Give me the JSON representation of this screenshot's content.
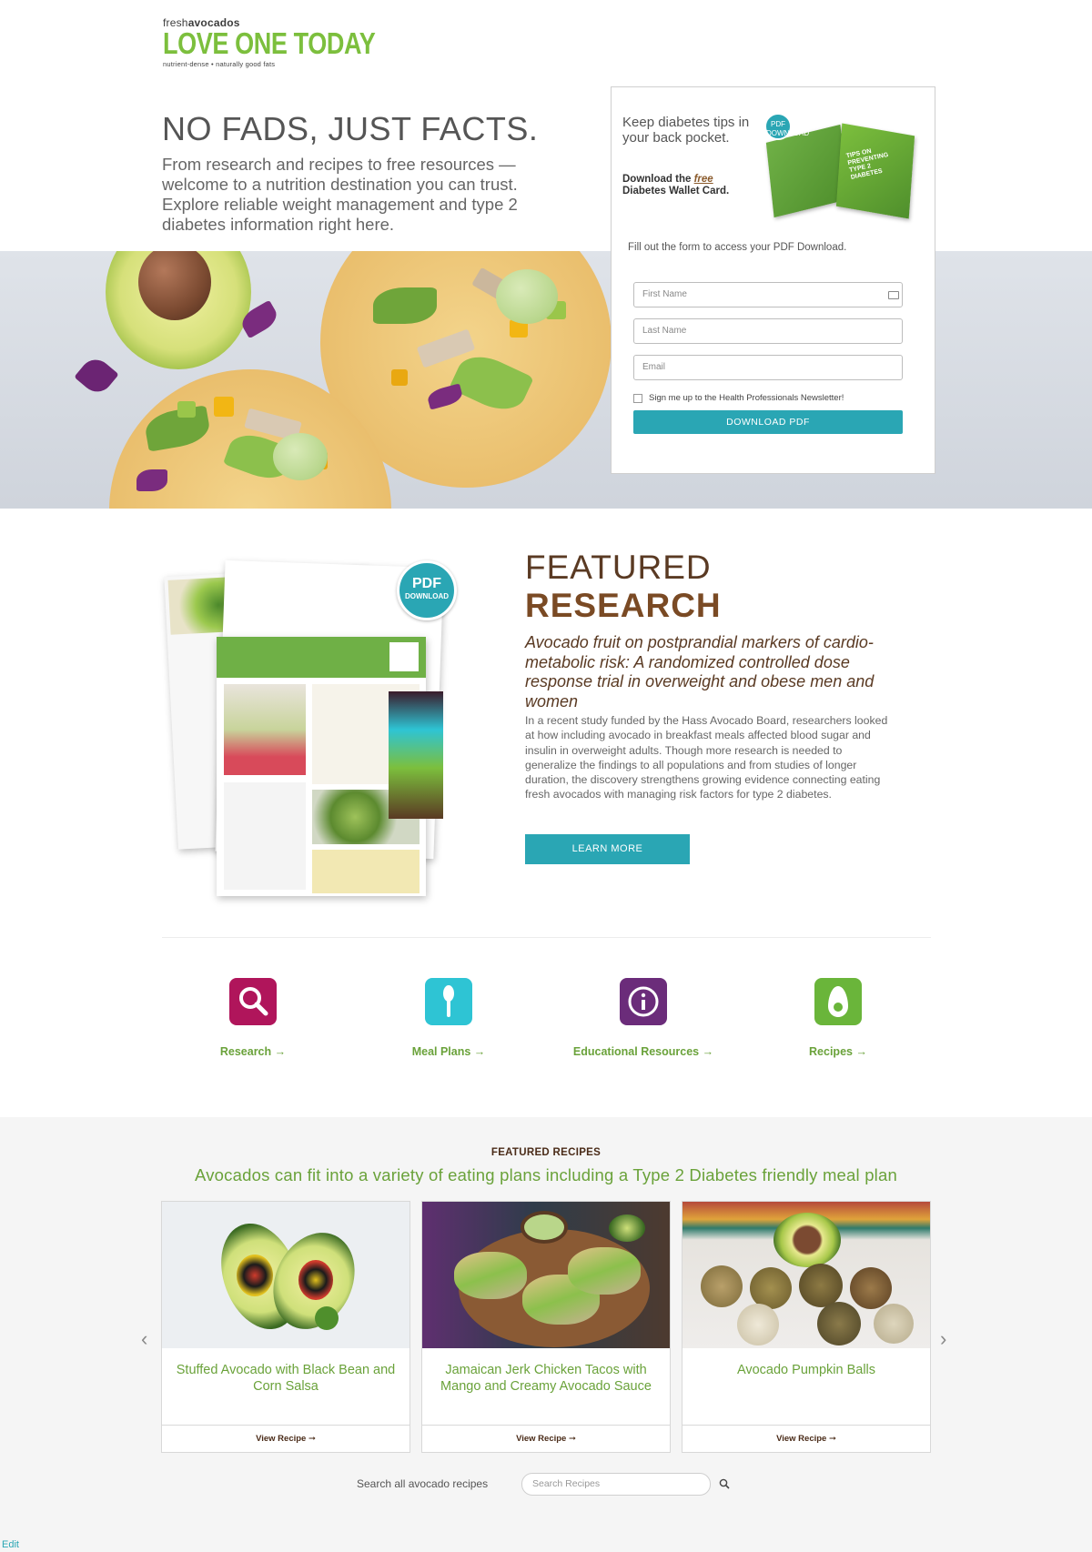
{
  "brand": {
    "logo_top_light": "fresh",
    "logo_top_bold": "avocados",
    "logo_main": "LOVE ONE TODAY",
    "logo_tagline": "nutrient-dense • naturally good fats"
  },
  "hero": {
    "title": "NO FADS, JUST FACTS.",
    "text": "From research and recipes to free resources — welcome to a nutrition destination you can trust. Explore reliable weight management and type 2 diabetes information right here."
  },
  "download_form": {
    "heading": "Keep diabetes tips in your back pocket.",
    "sub_prefix": "Download the ",
    "sub_free": "free",
    "sub_suffix": "Diabetes Wallet Card.",
    "badge": "PDF DOWNLOAD",
    "card_text": "TIPS ON PREVENTING TYPE 2 DIABETES",
    "instruction": "Fill out the form to access your PDF Download.",
    "first_name_placeholder": "First Name",
    "last_name_placeholder": "Last Name",
    "email_placeholder": "Email",
    "newsletter_label": "Sign me up to the Health Professionals Newsletter!",
    "button": "DOWNLOAD PDF"
  },
  "research": {
    "title_line1": "FEATURED",
    "title_line2": "RESEARCH",
    "badge_top": "PDF",
    "badge_bottom": "DOWNLOAD",
    "study_title": "Avocado fruit on postprandial markers of cardio-metabolic risk: A randomized controlled dose response trial in overweight and obese men and women",
    "body": "In a recent study funded by the Hass Avocado Board, researchers looked at how including avocado in breakfast meals affected blood sugar and insulin in overweight adults. Though more research is needed to generalize the findings to all populations and from studies of longer duration, the discovery strengthens growing evidence connecting eating fresh avocados with managing risk factors for type 2 diabetes.",
    "button": "LEARN MORE"
  },
  "categories": [
    {
      "label": "Research →",
      "icon": "search-icon",
      "color": "#b0155b"
    },
    {
      "label": "Meal Plans →",
      "icon": "spoon-icon",
      "color": "#2ec4d4"
    },
    {
      "label": "Educational Resources →",
      "icon": "info-icon",
      "color": "#6b2c7a"
    },
    {
      "label": "Recipes →",
      "icon": "avocado-icon",
      "color": "#6ab53a"
    }
  ],
  "recipes": {
    "eyebrow": "FEATURED RECIPES",
    "subtitle": "Avocados can fit into a variety of eating plans including a Type 2 Diabetes friendly meal plan",
    "items": [
      {
        "name": "Stuffed Avocado with Black Bean and Corn Salsa",
        "link": "View Recipe ➞"
      },
      {
        "name": "Jamaican Jerk Chicken Tacos with Mango and Creamy Avocado Sauce",
        "link": "View Recipe ➞"
      },
      {
        "name": "Avocado Pumpkin Balls",
        "link": "View Recipe ➞"
      }
    ],
    "prev_arrow": "‹",
    "next_arrow": "›",
    "search_label": "Search all avocado recipes",
    "search_placeholder": "Search Recipes"
  },
  "footer": {
    "edit_link": "Edit"
  },
  "colors": {
    "teal": "#2aa6b4",
    "green": "#6aa23a",
    "brown": "#7a4a24"
  }
}
